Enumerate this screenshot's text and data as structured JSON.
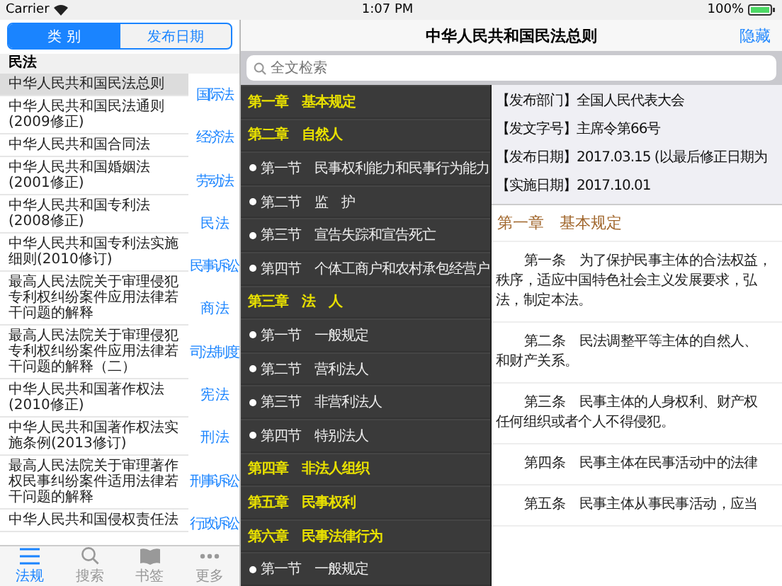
{
  "status_bar": {
    "carrier": "Carrier",
    "time": "1:07 PM",
    "battery": "100%"
  },
  "segments": [
    {
      "label": "类 别",
      "selected": true
    },
    {
      "label": "发布日期",
      "selected": false
    }
  ],
  "section_header": "民法",
  "laws": [
    {
      "title": "中华人民共和国民法总则",
      "selected": true
    },
    {
      "title": "中华人民共和国民法通则(2009修正)",
      "selected": false
    },
    {
      "title": "中华人民共和国合同法",
      "selected": false
    },
    {
      "title": "中华人民共和国婚姻法(2001修正)",
      "selected": false
    },
    {
      "title": "中华人民共和国专利法(2008修正)",
      "selected": false
    },
    {
      "title": "中华人民共和国专利法实施细则(2010修订)",
      "selected": false
    },
    {
      "title": "最高人民法院关于审理侵犯专利权纠纷案件应用法律若干问题的解释",
      "selected": false
    },
    {
      "title": "最高人民法院关于审理侵犯专利权纠纷案件应用法律若干问题的解释（二）",
      "selected": false
    },
    {
      "title": "中华人民共和国著作权法(2010修正)",
      "selected": false
    },
    {
      "title": "中华人民共和国著作权法实施条例(2013修订)",
      "selected": false
    },
    {
      "title": "最高人民法院关于审理著作权民事纠纷案件适用法律若干问题的解释",
      "selected": false
    },
    {
      "title": "中华人民共和国侵权责任法",
      "selected": false
    }
  ],
  "index": [
    "国际法",
    "经济法",
    "劳动法",
    "民 法",
    "民事诉讼",
    "商 法",
    "司法制度",
    "宪 法",
    "刑 法",
    "刑事诉讼",
    "行政诉讼"
  ],
  "tab_bar": [
    {
      "kind": "list",
      "label": "法规",
      "selected": true
    },
    {
      "kind": "search",
      "label": "搜索",
      "selected": false
    },
    {
      "kind": "book",
      "label": "书签",
      "selected": false
    },
    {
      "kind": "more",
      "label": "更多",
      "selected": false
    }
  ],
  "nav": {
    "title": "中华人民共和国民法总则",
    "action": "隐藏"
  },
  "search": {
    "placeholder": "全文检索"
  },
  "outline": [
    {
      "kind": "chapter",
      "label": "第一章　基本规定"
    },
    {
      "kind": "chapter",
      "label": "第二章　自然人"
    },
    {
      "kind": "section",
      "label": "第一节　民事权利能力和民事行为能力"
    },
    {
      "kind": "section",
      "label": "第二节　监　护"
    },
    {
      "kind": "section",
      "label": "第三节　宣告失踪和宣告死亡"
    },
    {
      "kind": "section",
      "label": "第四节　个体工商户和农村承包经营户"
    },
    {
      "kind": "chapter",
      "label": "第三章　法　人"
    },
    {
      "kind": "section",
      "label": "第一节　一般规定"
    },
    {
      "kind": "section",
      "label": "第二节　营利法人"
    },
    {
      "kind": "section",
      "label": "第三节　非营利法人"
    },
    {
      "kind": "section",
      "label": "第四节　特别法人"
    },
    {
      "kind": "chapter",
      "label": "第四章　非法人组织"
    },
    {
      "kind": "chapter",
      "label": "第五章　民事权利"
    },
    {
      "kind": "chapter",
      "label": "第六章　民事法律行为"
    },
    {
      "kind": "section",
      "label": "第一节　一般规定"
    }
  ],
  "law_info": [
    "【发布部门】全国人民代表大会",
    "【发文字号】主席令第66号",
    "【发布日期】2017.03.15 (以最后修正日期为",
    "【实施日期】2017.10.01"
  ],
  "chapter_heading": "第一章　基本规定",
  "articles": [
    {
      "lines": [
        "第一条　为了保护民事主体的合法权益，",
        "秩序，适应中国特色社会主义发展要求，弘",
        "法，制定本法。"
      ]
    },
    {
      "lines": [
        "第二条　民法调整平等主体的自然人、",
        "和财产关系。"
      ]
    },
    {
      "lines": [
        "第三条　民事主体的人身权利、财产权",
        "任何组织或者个人不得侵犯。"
      ]
    },
    {
      "lines": [
        "第四条　民事主体在民事活动中的法律"
      ]
    },
    {
      "lines": [
        "第五条　民事主体从事民事活动，应当"
      ]
    }
  ]
}
